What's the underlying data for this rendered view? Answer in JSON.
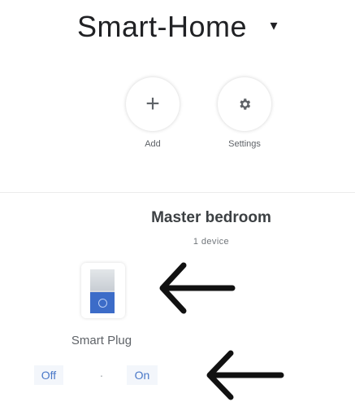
{
  "header": {
    "title": "Smart-Home",
    "dropdown_icon": "caret-down-icon"
  },
  "actions": [
    {
      "label": "Add",
      "icon": "plus-icon"
    },
    {
      "label": "Settings",
      "icon": "gear-icon"
    }
  ],
  "room": {
    "name": "Master bedroom",
    "device_count": "1 device"
  },
  "device": {
    "name": "Smart Plug",
    "icon": "smart-plug-icon",
    "off_label": "Off",
    "separator": "·",
    "on_label": "On"
  },
  "annotations": {
    "arrow_color": "#111111",
    "arrows": [
      "left-arrow-icon",
      "left-arrow-icon"
    ]
  }
}
